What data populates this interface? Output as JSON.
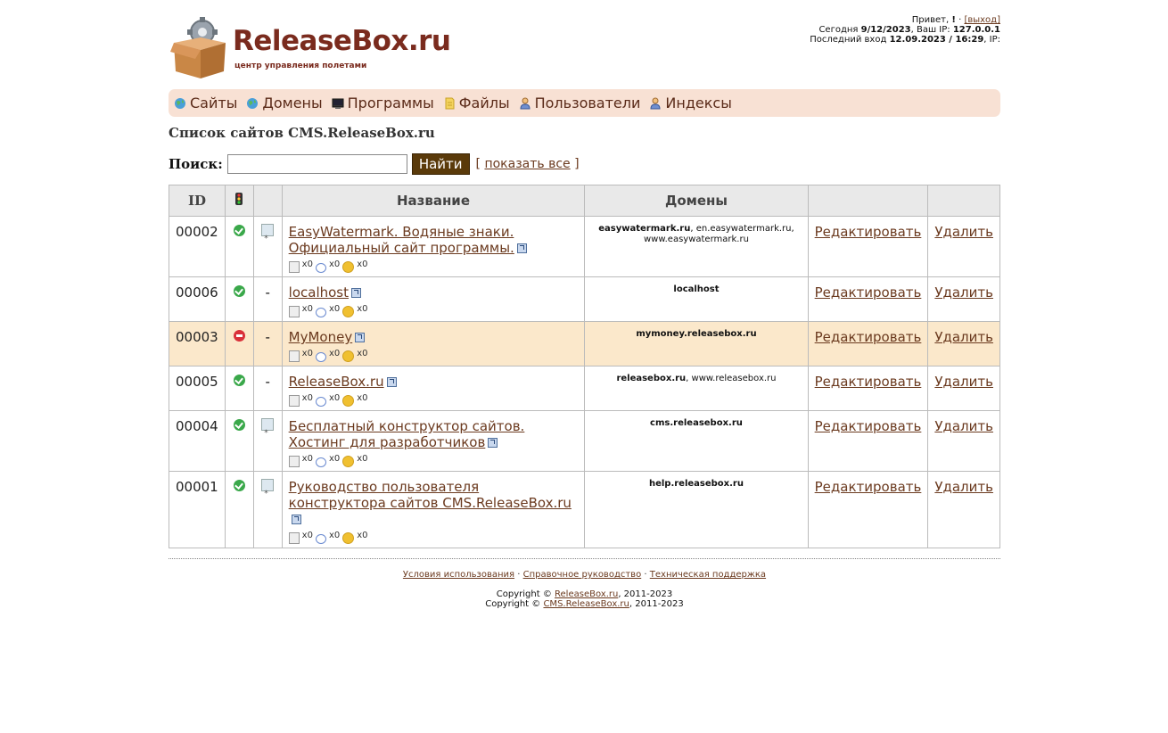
{
  "header": {
    "logo_title": "ReleaseBox.ru",
    "logo_subtitle": "центр управления полетами",
    "greeting": "Привет,",
    "greeting_name": "!",
    "logout_label": "[выход]",
    "today_label": "Сегодня",
    "today_value": "9/12/2023",
    "ip_label": ", Ваш IP:",
    "ip_value": "127.0.0.1",
    "last_login_label": "Последний вход",
    "last_login_value": "12.09.2023 / 16:29",
    "last_ip_label": ", IP:"
  },
  "nav": {
    "items": [
      {
        "label": "Сайты",
        "icon": "globe-icon"
      },
      {
        "label": "Домены",
        "icon": "globe-icon"
      },
      {
        "label": "Программы",
        "icon": "monitor-icon"
      },
      {
        "label": "Файлы",
        "icon": "file-icon"
      },
      {
        "label": "Пользователи",
        "icon": "user-icon"
      },
      {
        "label": "Индексы",
        "icon": "user-icon"
      }
    ]
  },
  "page_title": "Список сайтов CMS.ReleaseBox.ru",
  "search": {
    "label": "Поиск:",
    "value": "",
    "placeholder": "",
    "button_label": "Найти",
    "show_all_open": "[",
    "show_all_label": "показать все",
    "show_all_close": "]"
  },
  "table": {
    "headers": {
      "id": "ID",
      "status": "traffic-light-icon",
      "image": "",
      "name": "Название",
      "domains": "Домены",
      "edit": "",
      "delete": ""
    },
    "edit_label": "Редактировать",
    "delete_label": "Удалить",
    "stat_doc": "x0",
    "stat_comments": "x0",
    "stat_smiles": "x0",
    "rows": [
      {
        "id": "00002",
        "status": "ok",
        "image": "thumb",
        "name": "EasyWatermark. Водяные знаки. Официальный сайт программы.",
        "domain_main": "easywatermark.ru",
        "domain_rest": ", en.easywatermark.ru, www.easywatermark.ru",
        "highlight": false
      },
      {
        "id": "00006",
        "status": "ok",
        "image": "-",
        "name": "localhost",
        "domain_main": "localhost",
        "domain_rest": "",
        "highlight": false
      },
      {
        "id": "00003",
        "status": "disabled",
        "image": "-",
        "name": "MyMoney",
        "domain_main": "mymoney.releasebox.ru",
        "domain_rest": "",
        "highlight": true
      },
      {
        "id": "00005",
        "status": "ok",
        "image": "-",
        "name": "ReleaseBox.ru",
        "domain_main": "releasebox.ru",
        "domain_rest": ", www.releasebox.ru",
        "highlight": false
      },
      {
        "id": "00004",
        "status": "ok",
        "image": "thumb",
        "name": "Бесплатный конструктор сайтов. Хостинг для разработчиков",
        "domain_main": "cms.releasebox.ru",
        "domain_rest": "",
        "highlight": false
      },
      {
        "id": "00001",
        "status": "ok",
        "image": "thumb",
        "name": "Руководство пользователя конструктора сайтов CMS.ReleaseBox.ru",
        "domain_main": "help.releasebox.ru",
        "domain_rest": "",
        "highlight": false
      }
    ]
  },
  "footer": {
    "links": [
      "Условия использования",
      "Справочное руководство",
      "Техническая поддержка"
    ],
    "separator": "·",
    "copyright_prefix": "Copyright ©",
    "copyright_1_link": "ReleaseBox.ru",
    "copyright_1_years": ", 2011-2023",
    "copyright_2_link": "CMS.ReleaseBox.ru",
    "copyright_2_years": ", 2011-2023"
  },
  "colors": {
    "brand": "#7a2b1e",
    "nav_bg": "#f8e1d4",
    "link": "#6b3a1f",
    "highlight_row": "#fbe8cb",
    "button_bg": "#5a3a0a"
  }
}
